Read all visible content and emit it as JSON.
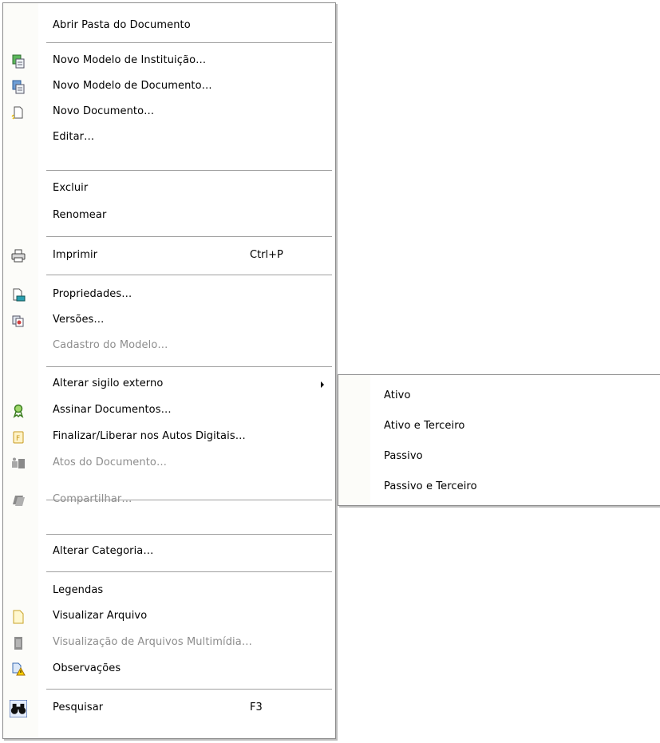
{
  "menu": {
    "items": [
      {
        "label": "Abrir Pasta do Documento",
        "icon": "none"
      },
      {
        "label": "Novo Modelo de Instituição…",
        "icon": "new-institution-template-icon"
      },
      {
        "label": "Novo Modelo de Documento…",
        "icon": "new-document-template-icon"
      },
      {
        "label": "Novo Documento…",
        "icon": "new-document-icon"
      },
      {
        "label": "Editar…",
        "icon": "none"
      },
      {
        "label": "Excluir",
        "icon": "none"
      },
      {
        "label": "Renomear",
        "icon": "none"
      },
      {
        "label": "Imprimir",
        "shortcut": "Ctrl+P",
        "icon": "printer-icon"
      },
      {
        "label": "Propriedades…",
        "icon": "properties-icon"
      },
      {
        "label": "Versões…",
        "icon": "versions-icon"
      },
      {
        "label": "Cadastro do Modelo…",
        "icon": "none",
        "disabled": true
      },
      {
        "label": "Alterar sigilo externo",
        "icon": "none",
        "submenu": true
      },
      {
        "label": "Assinar Documentos…",
        "icon": "sign-ribbon-icon"
      },
      {
        "label": "Finalizar/Liberar nos Autos Digitais…",
        "icon": "finalize-icon"
      },
      {
        "label": "Atos do Documento…",
        "icon": "document-acts-icon",
        "disabled": true
      },
      {
        "label": "Compartilhar…",
        "icon": "share-icon",
        "disabled": true
      },
      {
        "label": "Alterar Categoria…",
        "icon": "none"
      },
      {
        "label": "Legendas",
        "icon": "none"
      },
      {
        "label": "Visualizar Arquivo",
        "icon": "view-file-icon"
      },
      {
        "label": "Visualização de Arquivos Multimídia…",
        "icon": "multimedia-icon",
        "disabled": true
      },
      {
        "label": "Observações",
        "icon": "observations-warning-icon"
      },
      {
        "label": "Pesquisar",
        "shortcut": "F3",
        "icon": "binoculars-icon"
      }
    ]
  },
  "submenu": {
    "items": [
      {
        "label": "Ativo"
      },
      {
        "label": "Ativo e Terceiro"
      },
      {
        "label": "Passivo"
      },
      {
        "label": "Passivo e Terceiro"
      }
    ]
  },
  "colors": {
    "border": "#8c8c8c",
    "separator": "#a0a0a0",
    "icon_strip": "#fcfcf9",
    "disabled_text": "#8d8d8d"
  }
}
